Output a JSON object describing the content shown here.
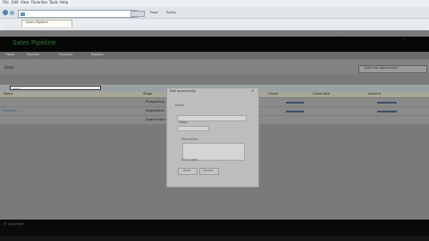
{
  "browser": {
    "menu": [
      "File",
      "Edit",
      "View",
      "Favorites",
      "Tools",
      "Help"
    ],
    "address": "...",
    "tab_label": "Sales Pipeline",
    "toolbar_items": [
      "Page",
      "Safety"
    ]
  },
  "app": {
    "title": "Sales Pipeline",
    "subtitle": "...",
    "header_right": "..."
  },
  "nav": {
    "items": [
      "Home",
      "Pipeline",
      "Forecast",
      "Reports"
    ]
  },
  "page": {
    "title": "Deals",
    "action_label": "Add new opportunity"
  },
  "search": {
    "placeholder": "Search"
  },
  "table": {
    "columns": [
      "Name",
      "Stage",
      "Owner",
      "Close date",
      "Amount"
    ],
    "rows": [
      {
        "name": "",
        "stage": "Prospecting",
        "owner": "",
        "date": "",
        "amount": ""
      },
      {
        "name": "",
        "stage": "Negotiation",
        "owner": "",
        "date": "",
        "amount": ""
      },
      {
        "name": "Account",
        "stage": "Qualification",
        "owner": "",
        "date": "",
        "amount": ""
      }
    ]
  },
  "modal": {
    "title": "Edit opportunity",
    "close": "×",
    "label1": "Name",
    "label2": "Stage",
    "label3": "Description",
    "label4": "Close date",
    "save": "Save",
    "cancel": "Cancel"
  },
  "footer": {
    "left": "© Copyright",
    "bottom": "",
    "right": ""
  },
  "colors": {
    "header_band": "#060806",
    "brand": "#2f7a34",
    "overlay": "#7a7a7a"
  }
}
